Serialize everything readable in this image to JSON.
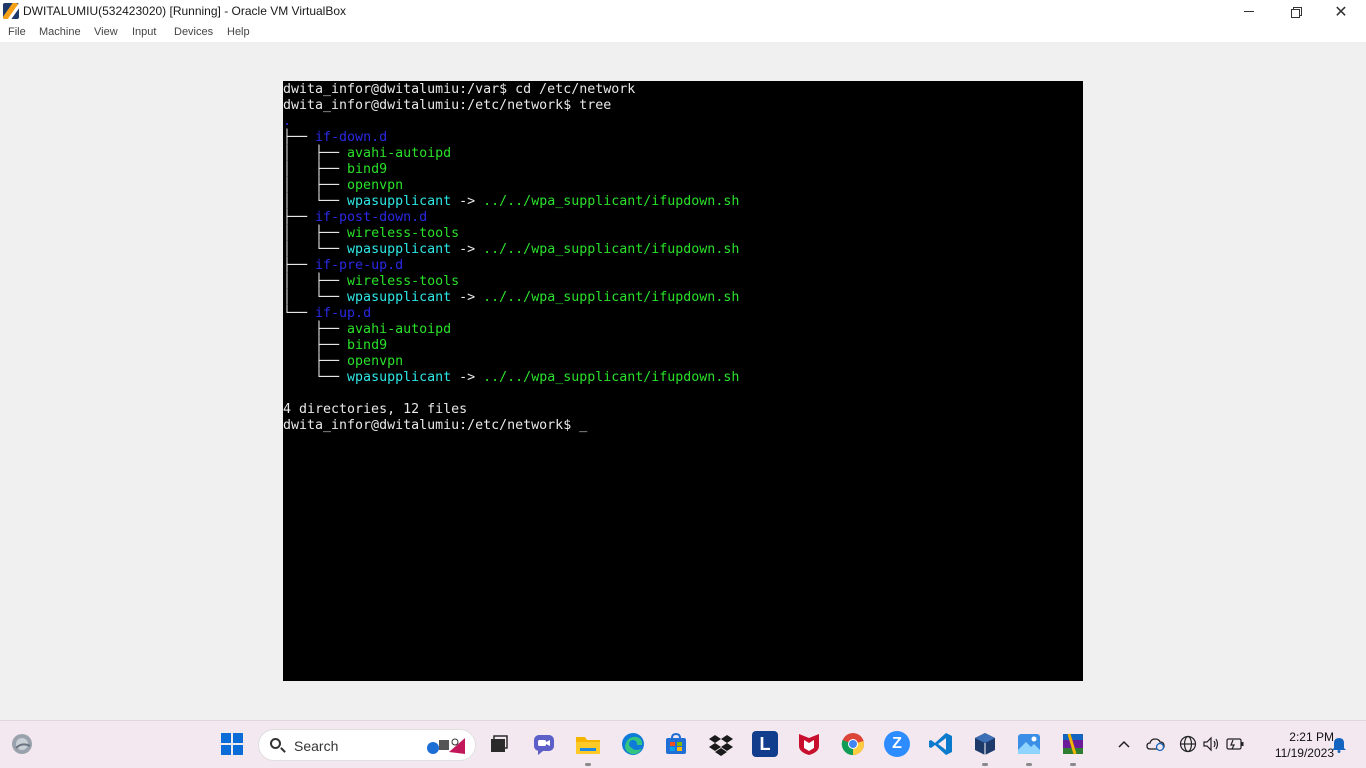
{
  "window": {
    "title": "DWITALUMIU(532423020) [Running] - Oracle VM VirtualBox",
    "close_glyph": "✕"
  },
  "menu": [
    "File",
    "Machine",
    "View",
    "Input",
    "Devices",
    "Help"
  ],
  "terminal": {
    "lines": [
      [
        {
          "t": "dwita_infor@dwitalumiu:/var$ cd /etc/network",
          "c": "c-tree"
        }
      ],
      [
        {
          "t": "dwita_infor@dwitalumiu:/etc/network$ tree",
          "c": "c-tree"
        }
      ],
      [
        {
          "t": ".",
          "c": "c-dir"
        }
      ],
      [
        {
          "t": "├── ",
          "c": "c-tree"
        },
        {
          "t": "if-down.d",
          "c": "c-dir"
        }
      ],
      [
        {
          "t": "│   ├── ",
          "c": "c-tree"
        },
        {
          "t": "avahi-autoipd",
          "c": "c-file"
        }
      ],
      [
        {
          "t": "│   ├── ",
          "c": "c-tree"
        },
        {
          "t": "bind9",
          "c": "c-file"
        }
      ],
      [
        {
          "t": "│   ├── ",
          "c": "c-tree"
        },
        {
          "t": "openvpn",
          "c": "c-file"
        }
      ],
      [
        {
          "t": "│   └── ",
          "c": "c-tree"
        },
        {
          "t": "wpasupplicant",
          "c": "c-link"
        },
        {
          "t": " -> ",
          "c": "c-tree"
        },
        {
          "t": "../../wpa_supplicant/ifupdown.sh",
          "c": "c-file"
        }
      ],
      [
        {
          "t": "├── ",
          "c": "c-tree"
        },
        {
          "t": "if-post-down.d",
          "c": "c-dir"
        }
      ],
      [
        {
          "t": "│   ├── ",
          "c": "c-tree"
        },
        {
          "t": "wireless-tools",
          "c": "c-file"
        }
      ],
      [
        {
          "t": "│   └── ",
          "c": "c-tree"
        },
        {
          "t": "wpasupplicant",
          "c": "c-link"
        },
        {
          "t": " -> ",
          "c": "c-tree"
        },
        {
          "t": "../../wpa_supplicant/ifupdown.sh",
          "c": "c-file"
        }
      ],
      [
        {
          "t": "├── ",
          "c": "c-tree"
        },
        {
          "t": "if-pre-up.d",
          "c": "c-dir"
        }
      ],
      [
        {
          "t": "│   ├── ",
          "c": "c-tree"
        },
        {
          "t": "wireless-tools",
          "c": "c-file"
        }
      ],
      [
        {
          "t": "│   └── ",
          "c": "c-tree"
        },
        {
          "t": "wpasupplicant",
          "c": "c-link"
        },
        {
          "t": " -> ",
          "c": "c-tree"
        },
        {
          "t": "../../wpa_supplicant/ifupdown.sh",
          "c": "c-file"
        }
      ],
      [
        {
          "t": "└── ",
          "c": "c-tree"
        },
        {
          "t": "if-up.d",
          "c": "c-dir"
        }
      ],
      [
        {
          "t": "    ├── ",
          "c": "c-tree"
        },
        {
          "t": "avahi-autoipd",
          "c": "c-file"
        }
      ],
      [
        {
          "t": "    ├── ",
          "c": "c-tree"
        },
        {
          "t": "bind9",
          "c": "c-file"
        }
      ],
      [
        {
          "t": "    ├── ",
          "c": "c-tree"
        },
        {
          "t": "openvpn",
          "c": "c-file"
        }
      ],
      [
        {
          "t": "    └── ",
          "c": "c-tree"
        },
        {
          "t": "wpasupplicant",
          "c": "c-link"
        },
        {
          "t": " -> ",
          "c": "c-tree"
        },
        {
          "t": "../../wpa_supplicant/ifupdown.sh",
          "c": "c-file"
        }
      ],
      [
        {
          "t": "",
          "c": "c-tree"
        }
      ],
      [
        {
          "t": "4 directories, 12 files",
          "c": "c-tree"
        }
      ],
      [
        {
          "t": "dwita_infor@dwitalumiu:/etc/network$ ",
          "c": "c-tree"
        },
        {
          "t": "_",
          "c": "cursor"
        }
      ]
    ]
  },
  "taskbar": {
    "search_label": "Search",
    "icons": [
      "weather-icon",
      "start-icon",
      "task-view-icon",
      "chat-icon",
      "file-explorer-icon",
      "edge-icon",
      "store-icon",
      "dropbox-icon",
      "l-app-icon",
      "mcafee-icon",
      "chrome-icon",
      "zoom-icon",
      "vscode-icon",
      "virtualbox-icon",
      "photos-icon",
      "winrar-icon"
    ],
    "l_app_letter": "L",
    "zoom_letter": "Z",
    "tray_icons": [
      "chevron-up-icon",
      "onedrive-icon",
      "globe-icon",
      "speaker-icon",
      "battery-icon",
      "bell-icon"
    ],
    "time": "2:21 PM",
    "date": "11/19/2023"
  },
  "colors": {
    "terminal_bg": "#000000",
    "dir": "#2a2ae6",
    "link": "#2ee6e6",
    "file": "#2ae02a",
    "taskbar_bg": "#f3e8ef",
    "start_blue": "#0a6cd6"
  }
}
